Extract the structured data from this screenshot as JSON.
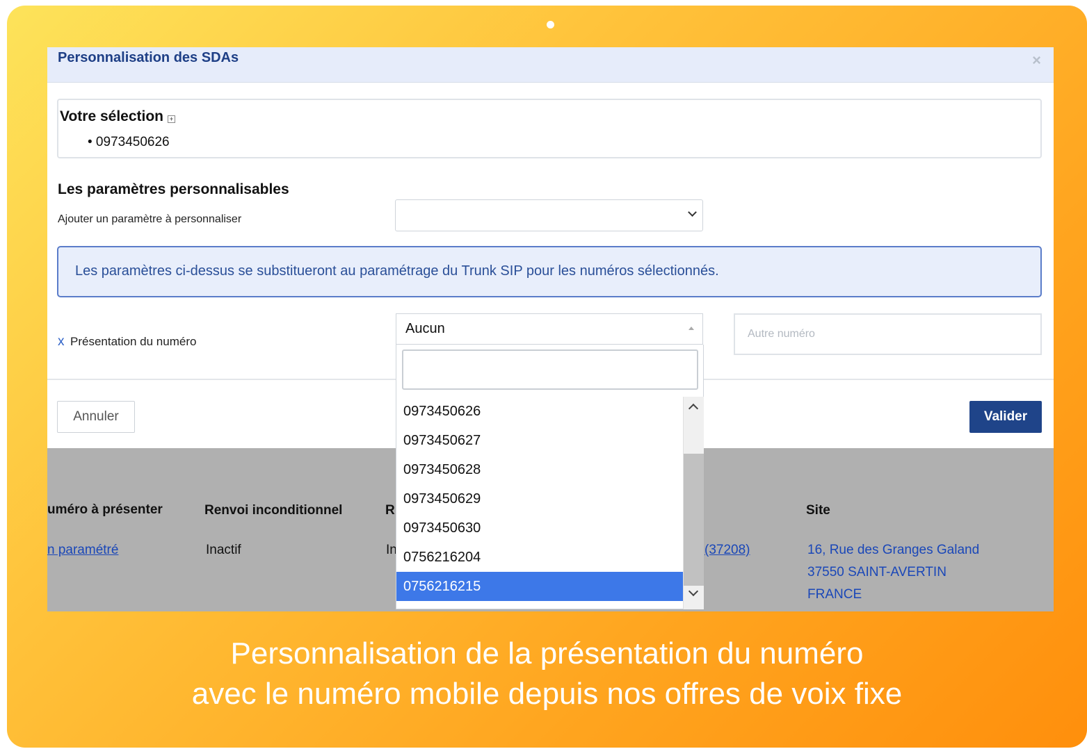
{
  "modal": {
    "title": "Personnalisation des SDAs",
    "close_label": "×",
    "selection_title": "Votre sélection",
    "selection_expand_icon": "plus-square-icon",
    "selection_items": [
      "• 0973450626"
    ],
    "params_title": "Les paramètres personnalisables",
    "add_param_label": "Ajouter un paramètre à personnaliser",
    "add_param_value": "",
    "info_text": "Les paramètres ci-dessus se substitueront au paramétrage du Trunk SIP pour les numéros sélectionnés.",
    "remove_label": "x",
    "presentation_label": "Présentation du numéro",
    "presentation_value": "Aucun",
    "other_number_placeholder": "Autre numéro",
    "cancel_label": "Annuler",
    "validate_label": "Valider"
  },
  "dropdown": {
    "search_value": "",
    "options": [
      "0973450626",
      "0973450627",
      "0973450628",
      "0973450629",
      "0973450630",
      "0756216204",
      "0756216215"
    ],
    "selected": "0756216215"
  },
  "background_table": {
    "headers": {
      "col1": "uméro à présenter",
      "col2": "Renvoi inconditionnel",
      "col3": "R",
      "col4": "Site"
    },
    "row": {
      "col1": "n paramétré",
      "col2": "Inactif",
      "col3": "In",
      "col_mid": "(37208)",
      "site_line1": "16, Rue des Granges Galand",
      "site_line2": "37550 SAINT-AVERTIN",
      "site_line3": "FRANCE"
    }
  },
  "caption": {
    "line1": "Personnalisation de la présentation du numéro",
    "line2": "avec le numéro mobile depuis nos offres de voix fixe"
  },
  "colors": {
    "brand_blue": "#1f4489",
    "title_blue": "#1e3f86",
    "selected_option": "#3d78e8",
    "frame_gradient_start": "#fde35a",
    "frame_gradient_end": "#ff8f0c"
  }
}
